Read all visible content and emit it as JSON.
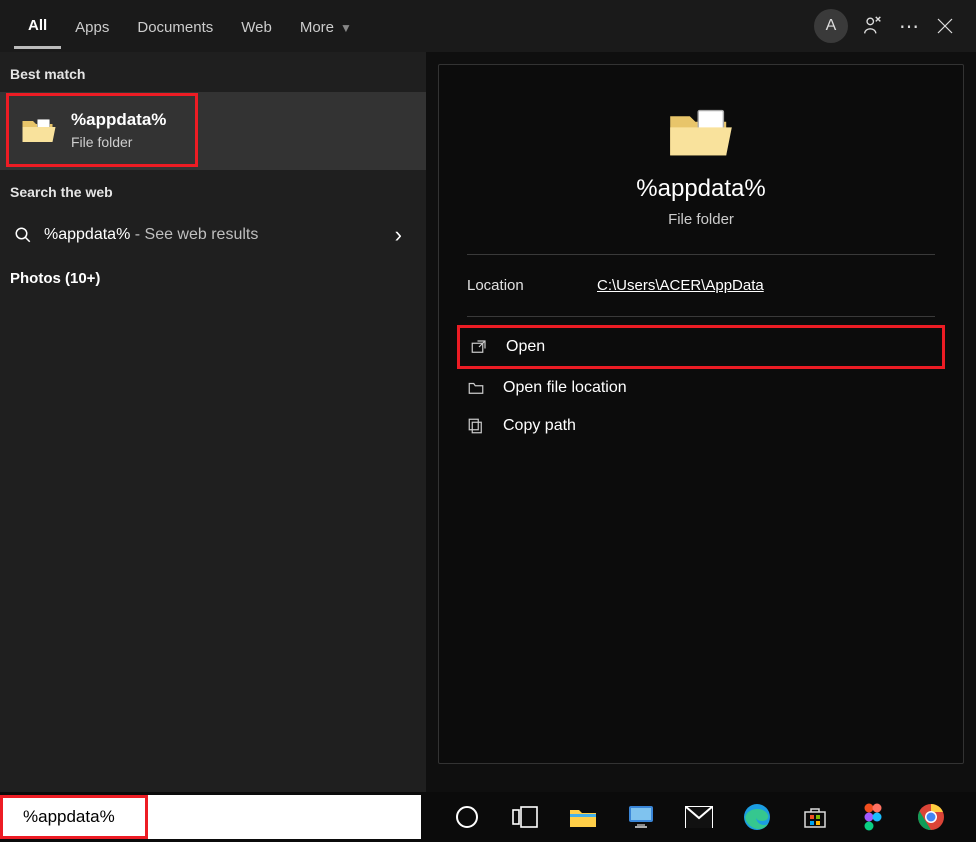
{
  "header": {
    "tabs": {
      "all": "All",
      "apps": "Apps",
      "documents": "Documents",
      "web": "Web",
      "more": "More"
    },
    "avatar_letter": "A"
  },
  "left": {
    "best_match_label": "Best match",
    "best_match": {
      "title": "%appdata%",
      "subtitle": "File folder"
    },
    "search_web_label": "Search the web",
    "web_result": {
      "query": "%appdata%",
      "suffix": " - See web results"
    },
    "photos_label": "Photos (10+)"
  },
  "preview": {
    "title": "%appdata%",
    "subtitle": "File folder",
    "location_label": "Location",
    "location_value": "C:\\Users\\ACER\\AppData",
    "actions": {
      "open": "Open",
      "open_location": "Open file location",
      "copy_path": "Copy path"
    }
  },
  "search": {
    "value": "%appdata%"
  }
}
